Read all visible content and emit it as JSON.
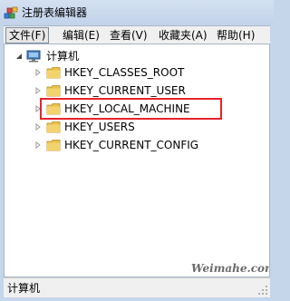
{
  "window": {
    "title": "注册表编辑器",
    "icon": "registry-editor-icon"
  },
  "menu": {
    "items": [
      {
        "label": "文件(F)"
      },
      {
        "label": "编辑(E)"
      },
      {
        "label": "查看(V)"
      },
      {
        "label": "收藏夹(A)"
      },
      {
        "label": "帮助(H)"
      }
    ]
  },
  "tree": {
    "root": {
      "label": "计算机",
      "icon": "computer-icon",
      "expanded": true
    },
    "items": [
      {
        "label": "HKEY_CLASSES_ROOT",
        "icon": "folder-icon",
        "highlighted": false
      },
      {
        "label": "HKEY_CURRENT_USER",
        "icon": "folder-icon",
        "highlighted": false
      },
      {
        "label": "HKEY_LOCAL_MACHINE",
        "icon": "folder-icon",
        "highlighted": true
      },
      {
        "label": "HKEY_USERS",
        "icon": "folder-icon",
        "highlighted": false
      },
      {
        "label": "HKEY_CURRENT_CONFIG",
        "icon": "folder-icon",
        "highlighted": false
      }
    ]
  },
  "status": {
    "text": "计算机"
  },
  "watermark": {
    "text": "Weimahe.com"
  },
  "colors": {
    "highlight_border": "#e8232a",
    "folder": "#e9c24a",
    "title_bar": "#c5d5ea"
  }
}
